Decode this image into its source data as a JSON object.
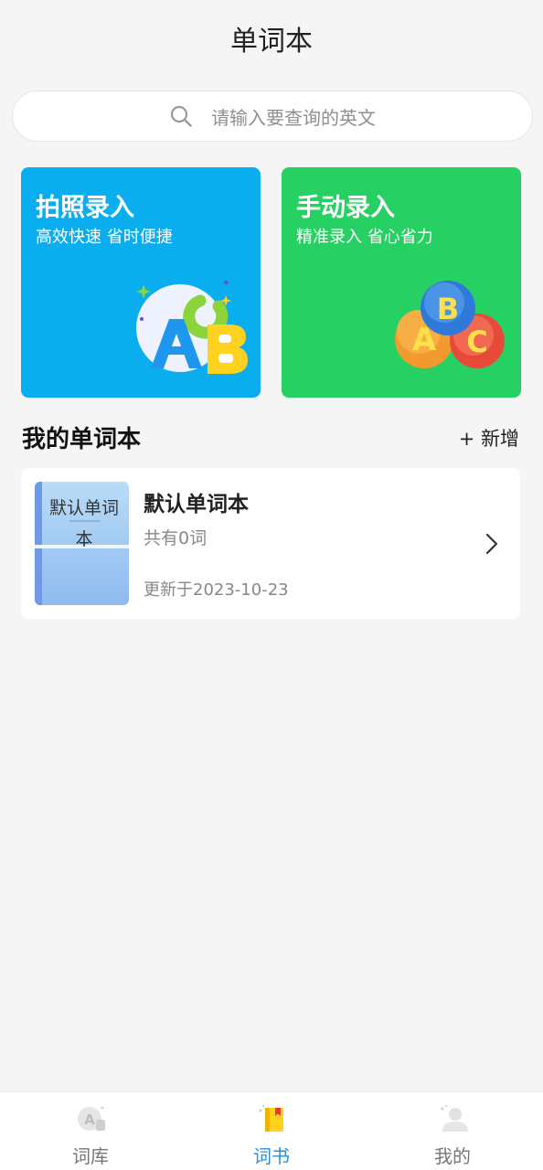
{
  "header": {
    "title": "单词本"
  },
  "search": {
    "placeholder": "请输入要查询的英文"
  },
  "cards": [
    {
      "title": "拍照录入",
      "subtitle": "高效快速 省时便捷",
      "color": "#0aaeee"
    },
    {
      "title": "手动录入",
      "subtitle": "精准录入 省心省力",
      "color": "#27d062"
    }
  ],
  "section": {
    "title": "我的单词本",
    "add_label": "+ 新增"
  },
  "notebook": {
    "cover_text": "默认单词本",
    "name": "默认单词本",
    "count": "共有0词",
    "updated": "更新于2023-10-23"
  },
  "tabbar": {
    "items": [
      {
        "label": "词库",
        "icon": "word-library-icon",
        "active": false
      },
      {
        "label": "词书",
        "icon": "word-book-icon",
        "active": true
      },
      {
        "label": "我的",
        "icon": "profile-icon",
        "active": false
      }
    ],
    "active_color": "#2b8fd6"
  }
}
